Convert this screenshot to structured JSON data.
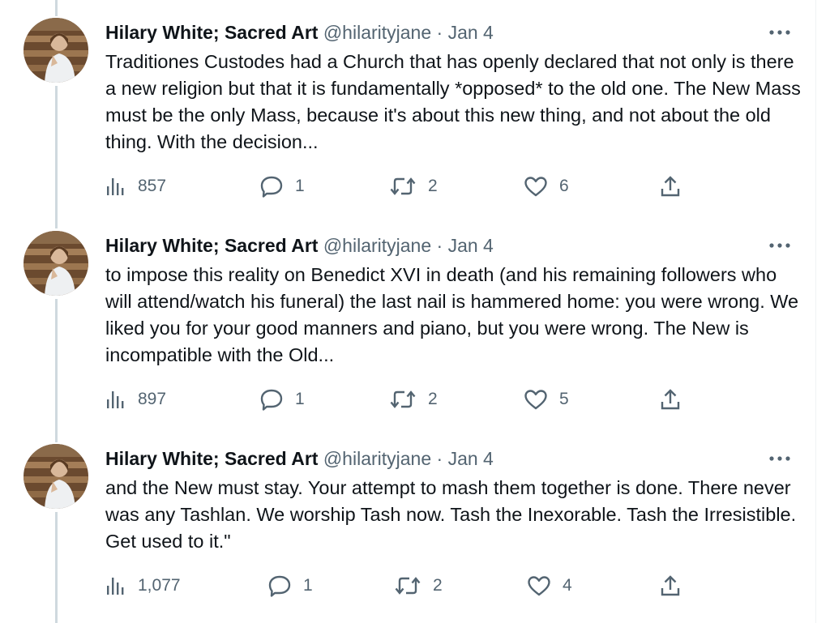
{
  "tweets": [
    {
      "name": "Hilary White; Sacred Art",
      "handle": "@hilarityjane",
      "separator": "·",
      "date": "Jan 4",
      "text": "Traditiones Custodes had a Church that has openly declared that not only is there a new religion but that it is fundamentally *opposed* to the old one. The New Mass must be the only Mass, because it's about this new thing, and not about the old thing. With the decision...",
      "views": "857",
      "replies": "1",
      "retweets": "2",
      "likes": "6"
    },
    {
      "name": "Hilary White; Sacred Art",
      "handle": "@hilarityjane",
      "separator": "·",
      "date": "Jan 4",
      "text": "to impose this reality on Benedict XVI in death (and his remaining followers who will attend/watch his funeral) the last nail is hammered home: you were wrong. We liked you for your good manners and piano, but you were wrong. The New is incompatible with the Old...",
      "views": "897",
      "replies": "1",
      "retweets": "2",
      "likes": "5"
    },
    {
      "name": "Hilary White; Sacred Art",
      "handle": "@hilarityjane",
      "separator": "·",
      "date": "Jan 4",
      "text": "and the New must stay. Your attempt to mash them together is done. There never was any Tashlan. We worship Tash now. Tash the Inexorable. Tash the Irresistible. Get used to it.\"",
      "views": "1,077",
      "replies": "1",
      "retweets": "2",
      "likes": "4"
    }
  ],
  "icons": {
    "views": "views-icon",
    "reply": "reply-icon",
    "retweet": "retweet-icon",
    "like": "heart-icon",
    "share": "share-icon",
    "more": "more-icon"
  },
  "colors": {
    "text": "#0f1419",
    "secondary": "#536471",
    "thread_line": "#cfd9de"
  }
}
